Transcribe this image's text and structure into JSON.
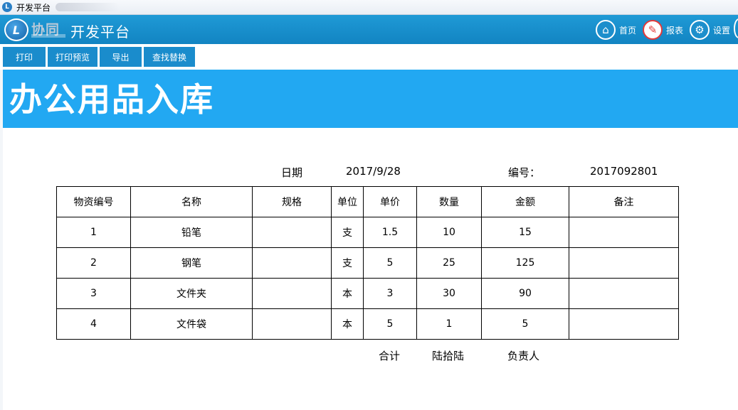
{
  "window": {
    "title": "开发平台"
  },
  "header": {
    "brand": "协同",
    "app_title": "开发平台",
    "nav": [
      {
        "label": "首页",
        "icon": "home-icon"
      },
      {
        "label": "报表",
        "icon": "report-icon"
      },
      {
        "label": "设置",
        "icon": "gear-icon"
      }
    ]
  },
  "toolbar": {
    "print": "打印",
    "print_preview": "打印预览",
    "export": "导出",
    "find_replace": "查找替换"
  },
  "report": {
    "title": "办公用品入库",
    "date_label": "日期",
    "date_value": "2017/9/28",
    "number_label": "编号：",
    "number_value": "2017092801",
    "columns": [
      "物资编号",
      "名称",
      "规格",
      "单位",
      "单价",
      "数量",
      "金额",
      "备注"
    ],
    "rows": [
      [
        "1",
        "铅笔",
        "",
        "支",
        "1.5",
        "10",
        "15",
        ""
      ],
      [
        "2",
        "钢笔",
        "",
        "支",
        "5",
        "25",
        "125",
        ""
      ],
      [
        "3",
        "文件夹",
        "",
        "本",
        "3",
        "30",
        "90",
        ""
      ],
      [
        "4",
        "文件袋",
        "",
        "本",
        "5",
        "1",
        "5",
        ""
      ]
    ],
    "total_label": "合计",
    "total_value": "陆拾陆",
    "manager_label": "负责人"
  },
  "colors": {
    "header": "#1a8ccc",
    "banner": "#22a8f2"
  }
}
